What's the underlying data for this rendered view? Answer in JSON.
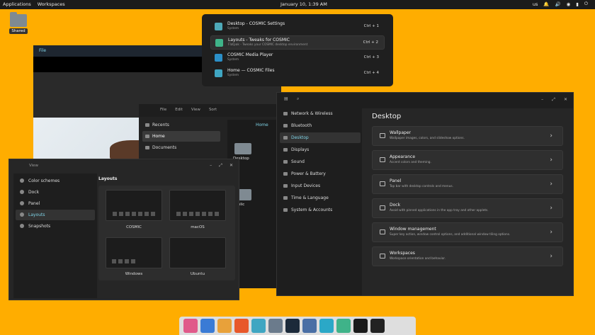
{
  "topbar": {
    "applications": "Applications",
    "workspaces": "Workspaces",
    "clock": "January 10, 1:39 AM",
    "keyboard": "us"
  },
  "desktop": {
    "folder_label": "Shared"
  },
  "media": {
    "menu": "File"
  },
  "launcher": {
    "results": [
      {
        "name": "Desktop - COSMIC Settings",
        "sub": "System",
        "key": "Ctrl + 1",
        "color": "#4ea9b8"
      },
      {
        "name": "Layouts - Tweaks for COSMIC",
        "sub": "Flatpak - Tweaks your COSMIC desktop environment",
        "key": "Ctrl + 2",
        "color": "#3fb389"
      },
      {
        "name": "COSMIC Media Player",
        "sub": "System",
        "key": "Ctrl + 3",
        "color": "#2b8fc7"
      },
      {
        "name": "Home — COSMIC Files",
        "sub": "System",
        "key": "Ctrl + 4",
        "color": "#3fa6c2"
      }
    ]
  },
  "files": {
    "menu": [
      "File",
      "Edit",
      "View",
      "Sort"
    ],
    "sidebar": [
      "Recents",
      "Home",
      "Documents"
    ],
    "path": "Home",
    "items": [
      "Desktop",
      "Public"
    ]
  },
  "tweaks": {
    "view": "View",
    "sidebar": [
      "Color schemes",
      "Dock",
      "Panel",
      "Layouts",
      "Snapshots"
    ],
    "heading": "Layouts",
    "layouts": [
      "COSMIC",
      "macOS",
      "Windows",
      "Ubuntu"
    ]
  },
  "settings": {
    "sidebar": [
      "Network & Wireless",
      "Bluetooth",
      "Desktop",
      "Displays",
      "Sound",
      "Power & Battery",
      "Input Devices",
      "Time & Language",
      "System & Accounts"
    ],
    "heading": "Desktop",
    "cards": [
      {
        "title": "Wallpaper",
        "desc": "Wallpaper images, colors, and slideshow options."
      },
      {
        "title": "Appearance",
        "desc": "Accent colors and theming."
      },
      {
        "title": "Panel",
        "desc": "Top bar with desktop controls and menus."
      },
      {
        "title": "Dock",
        "desc": "Avoid with pinned applications in the app tray and other applets."
      },
      {
        "title": "Window management",
        "desc": "Super key action, window control options, and additional window tiling options."
      },
      {
        "title": "Workspaces",
        "desc": "Workspace orientation and behavior."
      }
    ]
  },
  "dock": {
    "apps": [
      "#e05a8a",
      "#3a7bd5",
      "#e8a13a",
      "#e8582a",
      "#3fa6c2",
      "#6b7b8c",
      "#1c2a3a",
      "#4a6fa5",
      "#2ba8c7",
      "#3fb389",
      "#1b1b1b",
      "#222222"
    ]
  }
}
